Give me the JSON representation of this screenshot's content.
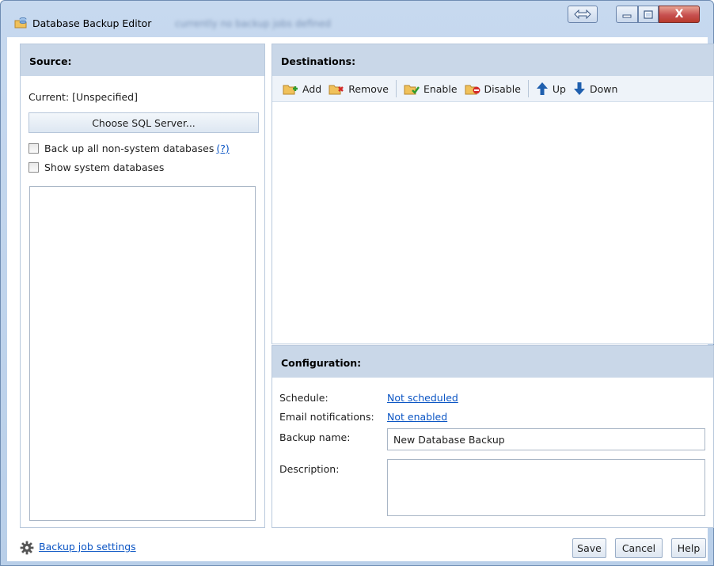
{
  "window": {
    "title": "Database Backup Editor",
    "subtitle": "currently no backup jobs defined",
    "close_glyph": "X"
  },
  "source": {
    "header": "Source:",
    "current_label": "Current:",
    "current_value": "[Unspecified]",
    "choose_button": "Choose SQL Server...",
    "backup_all_label": "Back up all non-system databases",
    "backup_all_help": "(?)",
    "show_system_label": "Show system databases"
  },
  "destinations": {
    "header": "Destinations:",
    "toolbar": {
      "add": "Add",
      "remove": "Remove",
      "enable": "Enable",
      "disable": "Disable",
      "up": "Up",
      "down": "Down"
    }
  },
  "configuration": {
    "header": "Configuration:",
    "schedule_label": "Schedule:",
    "schedule_value": "Not scheduled",
    "email_label": "Email notifications:",
    "email_value": "Not enabled",
    "backup_name_label": "Backup name:",
    "backup_name_value": "New Database Backup",
    "description_label": "Description:",
    "description_value": ""
  },
  "footer": {
    "settings_link": "Backup job settings",
    "save": "Save",
    "cancel": "Cancel",
    "help": "Help"
  },
  "icons": {
    "app": "database-backup-icon",
    "swap": "swap-arrows-icon",
    "minimize": "minimize-icon",
    "maximize": "maximize-icon",
    "close": "close-icon",
    "add": "add-destination-icon",
    "remove": "remove-destination-icon",
    "enable": "enable-destination-icon",
    "disable": "disable-destination-icon",
    "up": "arrow-up-icon",
    "down": "arrow-down-icon",
    "settings": "gear-icon"
  },
  "colors": {
    "link": "#0b55c4",
    "panel_header": "#c9d7e8",
    "title_bar": "#c7d9ef",
    "close_button": "#c75050"
  }
}
